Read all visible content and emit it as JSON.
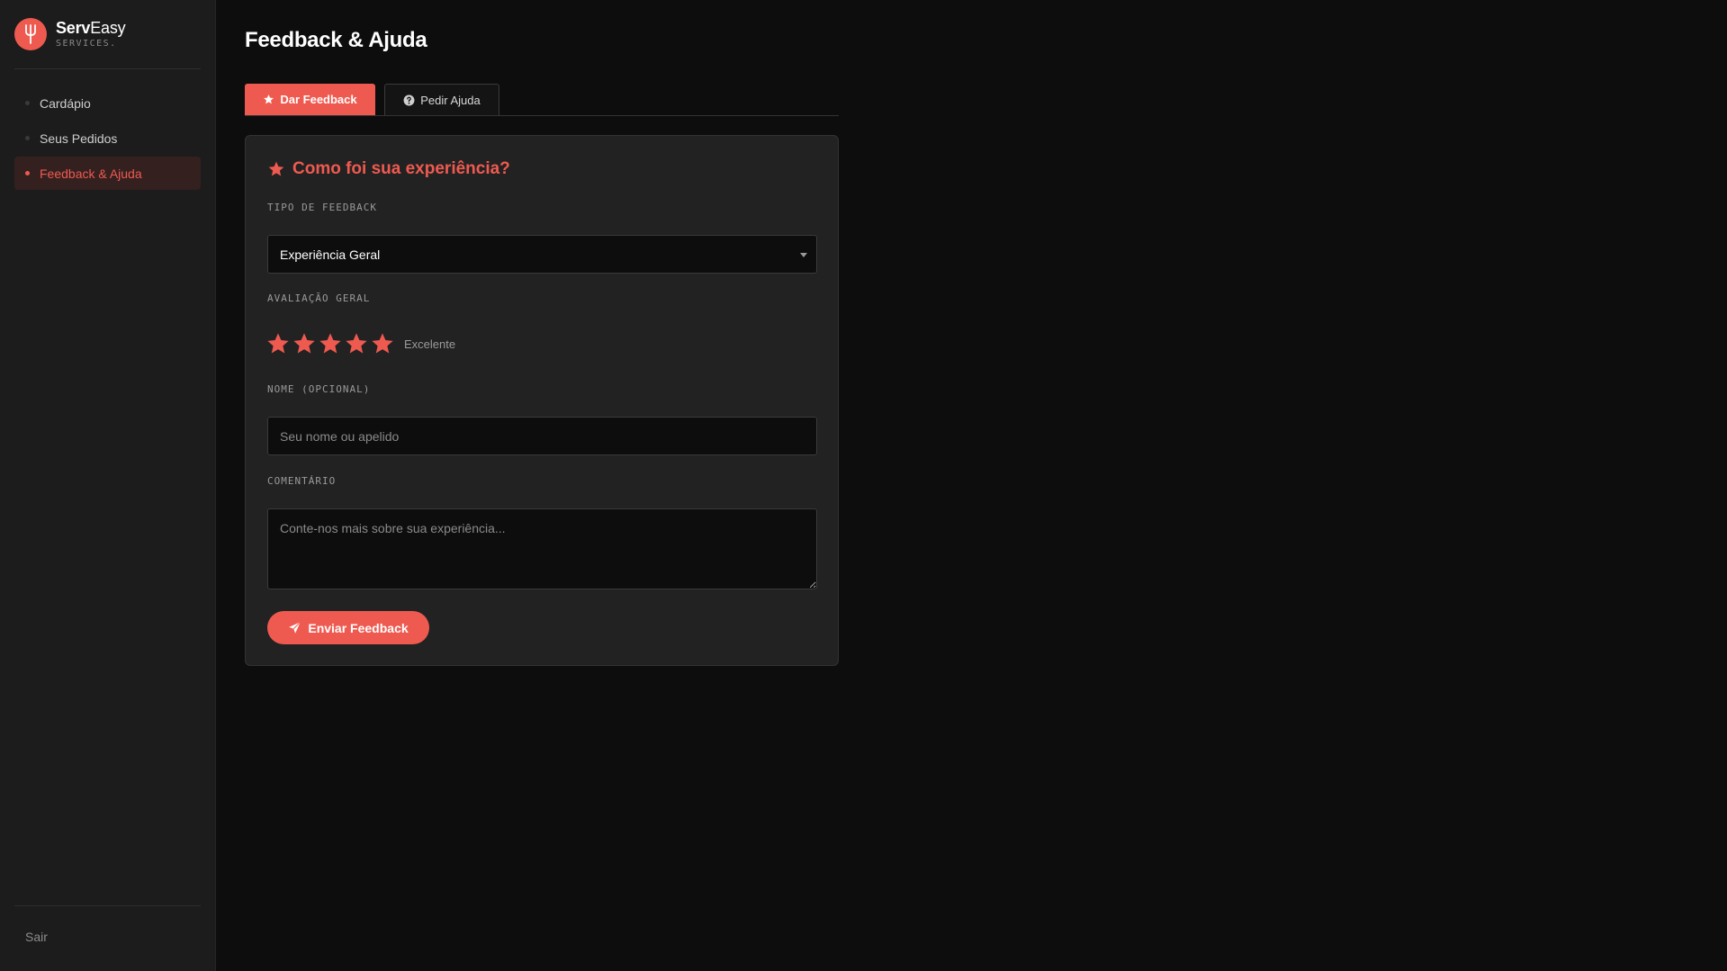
{
  "brand": {
    "name_bold": "Serv",
    "name_light": "Easy",
    "subtitle": "SERVICES."
  },
  "sidebar": {
    "items": [
      {
        "label": "Cardápio",
        "active": false
      },
      {
        "label": "Seus Pedidos",
        "active": false
      },
      {
        "label": "Feedback & Ajuda",
        "active": true
      }
    ],
    "logout_label": "Sair"
  },
  "page": {
    "title": "Feedback & Ajuda"
  },
  "tabs": [
    {
      "label": "Dar Feedback",
      "active": true,
      "icon": "star-icon"
    },
    {
      "label": "Pedir Ajuda",
      "active": false,
      "icon": "question-circle-icon"
    }
  ],
  "form": {
    "title": "Como foi sua experiência?",
    "feedback_type": {
      "label": "TIPO DE FEEDBACK",
      "selected": "Experiência Geral"
    },
    "rating": {
      "label": "AVALIAÇÃO GERAL",
      "value": 5,
      "max": 5,
      "text": "Excelente"
    },
    "name": {
      "label": "NOME (OPCIONAL)",
      "value": "",
      "placeholder": "Seu nome ou apelido"
    },
    "comment": {
      "label": "COMENTÁRIO",
      "value": "",
      "placeholder": "Conte-nos mais sobre sua experiência..."
    },
    "submit_label": "Enviar Feedback"
  },
  "colors": {
    "accent": "#ef5a50",
    "background": "#0d0d0d",
    "sidebar": "#1c1c1c",
    "card": "#222222"
  }
}
